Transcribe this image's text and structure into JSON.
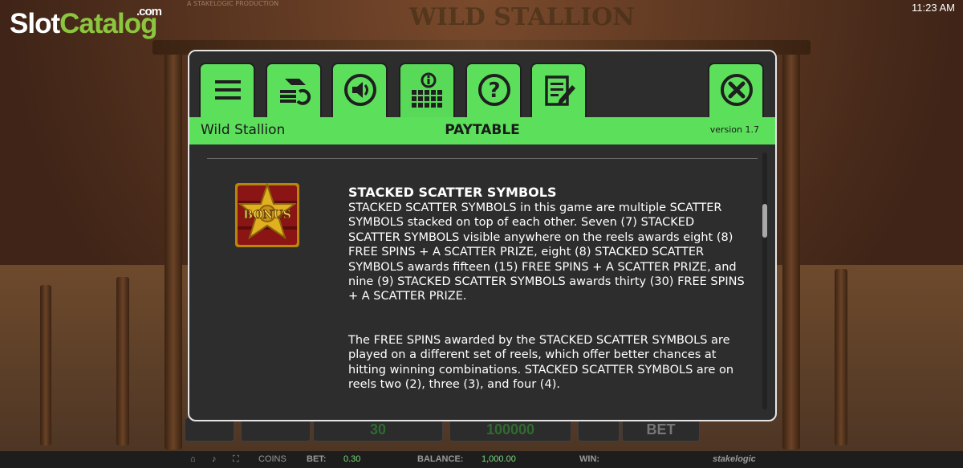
{
  "watermark": {
    "slot": "Slot",
    "catalog": "Catalog",
    "com": ".com"
  },
  "clock": "11:23 AM",
  "game": {
    "title": "WILD STALLION",
    "provider": "A STAKELOGIC PRODUCTION"
  },
  "dialog": {
    "tabs": [
      {
        "icon": "menu-icon"
      },
      {
        "icon": "autoplay-icon"
      },
      {
        "icon": "sound-icon"
      },
      {
        "icon": "paytable-icon",
        "active": true
      },
      {
        "icon": "help-icon"
      },
      {
        "icon": "history-icon"
      },
      {
        "icon": "close-icon"
      }
    ],
    "game_name": "Wild Stallion",
    "section": "PAYTABLE",
    "version": "version 1.7",
    "heading": "STACKED SCATTER SYMBOLS",
    "paragraph1": "STACKED SCATTER SYMBOLS in this game are multiple SCATTER SYMBOLS stacked on top of each other. Seven (7) STACKED SCATTER SYMBOLS visible anywhere on the reels awards eight (8) FREE SPINS + A SCATTER PRIZE, eight (8) STACKED SCATTER SYMBOLS awards fifteen (15) FREE SPINS + A SCATTER PRIZE, and nine (9) STACKED SCATTER SYMBOLS awards thirty (30) FREE SPINS + A SCATTER PRIZE.",
    "paragraph2": "The FREE SPINS awarded by the STACKED SCATTER SYMBOLS are played on a different set of reels, which offer better chances at hitting winning combinations. STACKED SCATTER SYMBOLS are on reels two (2), three (3), and four (4).",
    "symbol_label": "BONUS"
  },
  "controls": {
    "lines": "30",
    "bet_amount": "100000",
    "bet_label": "BET"
  },
  "status_bar": {
    "coins_label": "COINS",
    "bet_label": "BET:",
    "bet_value": "0.30",
    "balance_label": "BALANCE:",
    "balance_value": "1,000.00",
    "win_label": "WIN:",
    "brand": "stakelogic"
  },
  "colors": {
    "accent": "#5ce05c",
    "panel": "#2d2d2d",
    "text": "#ffffff"
  }
}
